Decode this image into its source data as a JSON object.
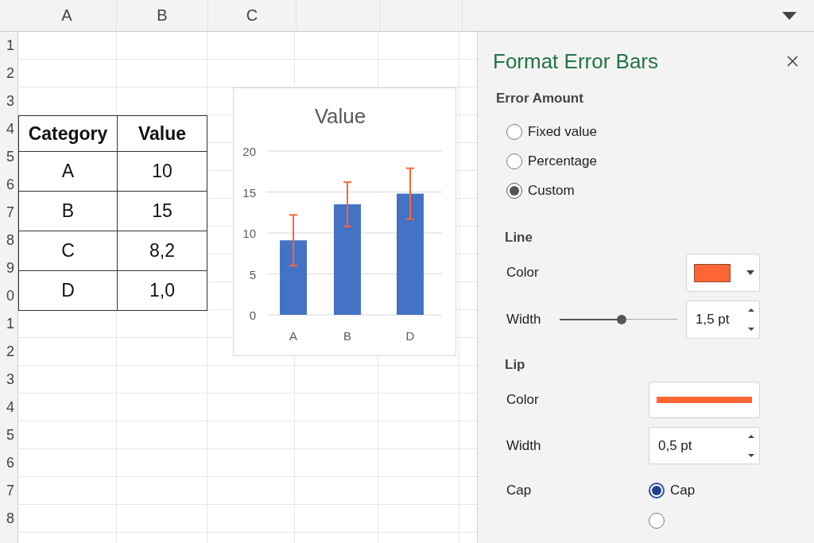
{
  "column_headers": [
    "A",
    "B",
    "C"
  ],
  "row_headers": [
    "1",
    "2",
    "3",
    "4",
    "5",
    "6",
    "7",
    "8",
    "9",
    "0",
    "1",
    "2",
    "3",
    "4",
    "5",
    "6",
    "7",
    "8"
  ],
  "data_table": {
    "header": [
      "Category",
      "Value"
    ],
    "rows": [
      [
        "A",
        "10"
      ],
      [
        "B",
        "15"
      ],
      [
        "C",
        "8,2"
      ],
      [
        "D",
        "1,0"
      ]
    ]
  },
  "chart": {
    "chart_data": {
      "type": "bar",
      "categories": [
        "A",
        "B",
        "D"
      ],
      "series": [
        {
          "name": "Value",
          "color": "#4472c4",
          "values": [
            9.1,
            13.5,
            14.8
          ],
          "errors": [
            3.1,
            2.7,
            3.1
          ]
        }
      ],
      "ylim": [
        0,
        20
      ],
      "yticks": [
        0,
        5,
        10,
        15,
        20
      ],
      "grid": true
    }
  },
  "panel": {
    "title": "Format Error Bars",
    "error_amount": {
      "heading": "Error Amount",
      "options": [
        {
          "label": "Fixed value",
          "selected": false
        },
        {
          "label": "Percentage",
          "selected": false
        },
        {
          "label": "Custom",
          "selected": true
        }
      ]
    },
    "line": {
      "heading": "Line",
      "color_label": "Color",
      "color": "#ff6633",
      "width_label": "Width",
      "level": 0.53,
      "width_value": "1,5 pt"
    },
    "lip": {
      "heading": "Lip",
      "color_label": "Color",
      "color": "#ff6633",
      "width_label": "Width",
      "width_value": "0,5 pt",
      "cap_label": "Cap",
      "cap_options": [
        {
          "label": "Cap",
          "selected": true
        },
        {
          "selected": false
        }
      ]
    }
  }
}
